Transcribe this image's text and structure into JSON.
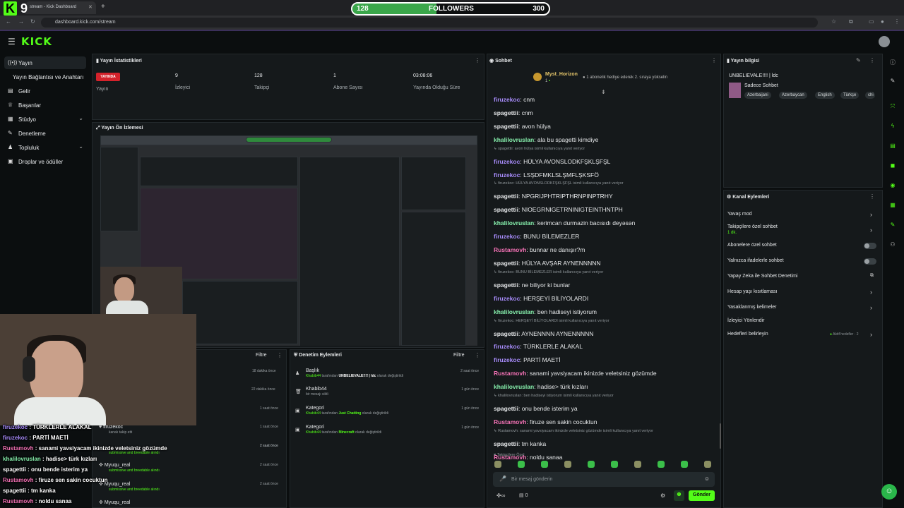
{
  "browser": {
    "tab_title": "stream - Kick Dashboard",
    "url": "dashboard.kick.com/stream"
  },
  "overlay": {
    "logo_letter": "K",
    "logo_number": "9",
    "followers_label": "FOLLOWERS",
    "followers_current": "128",
    "followers_goal": "300",
    "followers_progress_fraction": 0.4267
  },
  "app": {
    "logo": "KICK"
  },
  "sidebar": {
    "items": [
      {
        "label": "Yayın",
        "icon": "broadcast-icon"
      },
      {
        "label": "Yayın Bağlantısı ve Anahtarı",
        "icon": ""
      },
      {
        "label": "Gelir",
        "icon": "wallet-icon"
      },
      {
        "label": "Başarılar",
        "icon": "trophy-icon"
      },
      {
        "label": "Stüdyo",
        "icon": "studio-icon"
      },
      {
        "label": "Denetleme",
        "icon": "wrench-icon"
      },
      {
        "label": "Topluluk",
        "icon": "users-icon"
      },
      {
        "label": "Droplar ve ödüller",
        "icon": "gift-icon"
      }
    ]
  },
  "stats": {
    "title": "Yayın İstatistikleri",
    "live_badge": "YAYINDA",
    "items": [
      {
        "value": "",
        "label": "Yayın"
      },
      {
        "value": "9",
        "label": "İzleyici"
      },
      {
        "value": "128",
        "label": "Takipçi"
      },
      {
        "value": "1",
        "label": "Abone Sayısı"
      },
      {
        "value": "03:08:06",
        "label": "Yayında Olduğu Süre"
      }
    ]
  },
  "preview": {
    "title": "Yayın Ön İzlemesi"
  },
  "overlay_chat": [
    {
      "user": "firuzekoc",
      "text": " : TÜRKLERLE ALAKAL",
      "color": "#a78bfa"
    },
    {
      "user": "firuzekoc",
      "text": " : PARTİ MAETİ",
      "color": "#a78bfa"
    },
    {
      "user": "Rustamovh",
      "text": " : sanami yavsiyacam ikinizde veletsiniz gözümde",
      "color": "#f472b6"
    },
    {
      "user": "khalilovruslan",
      "text": " : hadise> türk kızları",
      "color": "#86efac"
    },
    {
      "user": "spagettii",
      "text": " : onu bende isterim ya",
      "color": "#ffffff"
    },
    {
      "user": "Rustamovh",
      "text": " : firuze sen sakin cocuktun",
      "color": "#f472b6"
    },
    {
      "user": "spagettii",
      "text": " : tm kanka",
      "color": "#ffffff"
    },
    {
      "user": "Rustamovh",
      "text": " : noldu sanaa",
      "color": "#f472b6"
    }
  ],
  "activity": {
    "filter_label": "Filtre",
    "items": [
      {
        "title": "",
        "sub": "",
        "time": "18 dakika önce"
      },
      {
        "title": "",
        "sub": "",
        "time": "22 dakika önce"
      },
      {
        "title": "",
        "sub": "",
        "time": "1 saat önce"
      },
      {
        "title": "",
        "sub": "",
        "time": "1 saat önce"
      },
      {
        "title": "firuzekoc",
        "sub": "kanalı takip etti",
        "time": "1 saat önce"
      },
      {
        "title": "",
        "sub": "submissive and breedable alındı",
        "time": "2 saat önce"
      },
      {
        "title": "Myuqu_real",
        "sub": "submissive and breedable alındı",
        "time": "2 saat önce"
      },
      {
        "title": "Myuqu_real",
        "sub": "submissive and breedable alındı",
        "time": "2 saat önce"
      },
      {
        "title": "Myuqu_real",
        "sub": "",
        "time": ""
      }
    ]
  },
  "moderation": {
    "title": "Denetim Eylemleri",
    "filter_label": "Filtre",
    "items": [
      {
        "title": "Başlık",
        "actor": "Khabib44",
        "middle": " tarafından ",
        "value": "UNBELIEVALE!!!! | ldc",
        "tail": " olarak değiştirildi",
        "time": "2 saat önce"
      },
      {
        "title": "Khabib44",
        "actor": "",
        "middle": "bir mesajı sildi",
        "value": "",
        "tail": "",
        "time": "1 gün önce"
      },
      {
        "title": "Kategori",
        "actor": "Khabib44",
        "middle": " tarafından ",
        "value": "Just Chatting",
        "tail": " olarak değiştirildi",
        "time": "1 gün önce"
      },
      {
        "title": "Kategori",
        "actor": "Khabib44",
        "middle": " tarafından ",
        "value": "Minecraft",
        "tail": " olarak değiştirildi",
        "time": "1 gün önce"
      }
    ]
  },
  "chat": {
    "title": "Sohbet",
    "pinned_user": "Myst_Horizon",
    "pinned_count": "1",
    "pinned_text": "1 abonelik hediye ederek 2. sıraya yükselin",
    "messages": [
      {
        "user": "firuzekoc",
        "text": "cnm",
        "color": "#a78bfa"
      },
      {
        "user": "spagettii",
        "text": "cnm",
        "color": "#e6e8ea"
      },
      {
        "user": "spagettii",
        "text": "avon hülya",
        "color": "#e6e8ea"
      },
      {
        "user": "khalilovruslan",
        "text": "ala bu spagetti kimdiye",
        "color": "#86efac"
      },
      {
        "reply": "spagettii: avon hülya isimli kullanıcıya yanıt veriyor"
      },
      {
        "user": "firuzekoc",
        "text": "HÜLYA AVONSLODKFŞKLŞFŞL",
        "color": "#a78bfa"
      },
      {
        "user": "firuzekoc",
        "text": "LSŞDFMKLSLŞMFLŞKSFÖ",
        "color": "#a78bfa"
      },
      {
        "reply": "firuzekoc: HÜLYA AVONSLODKFŞKLŞFŞL isimli kullanıcıya yanıt veriyor"
      },
      {
        "user": "spagettii",
        "text": "NPGRIJPHTRIPTHRNPINPTRHY",
        "color": "#e6e8ea"
      },
      {
        "user": "spagettii",
        "text": "NIOEGRNIGETRNINIGTEINTHNTPH",
        "color": "#e6e8ea"
      },
      {
        "user": "khalilovruslan",
        "text": "kerimcan durmazin bacısıdı deyəsən",
        "color": "#86efac"
      },
      {
        "user": "firuzekoc",
        "text": "BUNU BİLEMEZLER",
        "color": "#a78bfa"
      },
      {
        "user": "Rustamovh",
        "text": "bunnar ne danışır?m",
        "color": "#f472b6"
      },
      {
        "user": "spagettii",
        "text": "HÜLYA AVŞAR AYNENNNNN",
        "color": "#e6e8ea"
      },
      {
        "reply": "firuzekoc: BUNU BİLEMEZLER isimli kullanıcıya yanıt veriyor"
      },
      {
        "user": "spagettii",
        "text": "ne biliyor ki bunlar",
        "color": "#e6e8ea"
      },
      {
        "user": "firuzekoc",
        "text": "HERŞEYİ BİLİYOLARDI",
        "color": "#a78bfa"
      },
      {
        "user": "khalilovruslan",
        "text": "ben hadiseyi istiyorum",
        "color": "#86efac"
      },
      {
        "reply": "firuzekoc: HERŞEYİ BİLİYOLARDI isimli kullanıcıya yanıt veriyor"
      },
      {
        "user": "spagettii",
        "text": "AYNENNNN AYNENNNNN",
        "color": "#e6e8ea"
      },
      {
        "user": "firuzekoc",
        "text": "TÜRKLERLE ALAKAL",
        "color": "#a78bfa"
      },
      {
        "user": "firuzekoc",
        "text": "PARTİ MAETİ",
        "color": "#a78bfa"
      },
      {
        "user": "Rustamovh",
        "text": "sanami yavsiyacam ikinizde veletsiniz gözümde",
        "color": "#f472b6"
      },
      {
        "user": "khalilovruslan",
        "text": "hadise> türk kızları",
        "color": "#86efac"
      },
      {
        "reply": "khalilovruslan: ben hadiseyi istiyorum isimli kullanıcıya yanıt veriyor"
      },
      {
        "user": "spagettii",
        "text": "onu bende isterim ya",
        "color": "#e6e8ea"
      },
      {
        "user": "Rustamovh",
        "text": "firuze sen sakin cocuktun",
        "color": "#f472b6"
      },
      {
        "reply": "Rustamovh: sanami yavsiyacam ikinizde veletsiniz gözümde isimli kullanıcıya yanıt veriyor"
      },
      {
        "user": "spagettii",
        "text": "tm kanka",
        "color": "#e6e8ea"
      },
      {
        "user": "Rustamovh",
        "text": "noldu sanaa",
        "color": "#f472b6"
      }
    ],
    "followers_only_label": "Takipçilere Özel",
    "input_placeholder": "Bir mesaj gönderin",
    "count": "0",
    "send_label": "Gönder"
  },
  "stream_info": {
    "title": "Yayın bilgisi",
    "stream_title": "UNBELIEVALE!!!! | ldc",
    "category": "Sadece Sohbet",
    "tags": [
      "Azerbaijani",
      "Azerbaycan",
      "English",
      "Türkçe",
      "chi"
    ]
  },
  "channel_actions": {
    "title": "Kanal Eylemleri",
    "options": [
      {
        "label": "Yavaş mod",
        "control": "arrow"
      },
      {
        "label": "Takipçilere özel sohbet",
        "sub": "1 dk.",
        "control": "arrow"
      },
      {
        "label": "Abonelere özel sohbet",
        "control": "toggle"
      },
      {
        "label": "Yalnızca ifadelerle sohbet",
        "control": "toggle"
      },
      {
        "label": "Yapay Zeka ile Sohbet Denetimi",
        "control": "external"
      },
      {
        "label": "Hesap yaşı kısıtlaması",
        "control": "arrow"
      },
      {
        "label": "Yasaklanmış kelimeler",
        "control": "arrow"
      },
      {
        "label": "İzleyici Yönlendir",
        "control": "none"
      },
      {
        "label": "Hedefleri belirleyin",
        "badge": "Aktif hedefler · 2",
        "control": "arrow"
      }
    ]
  }
}
